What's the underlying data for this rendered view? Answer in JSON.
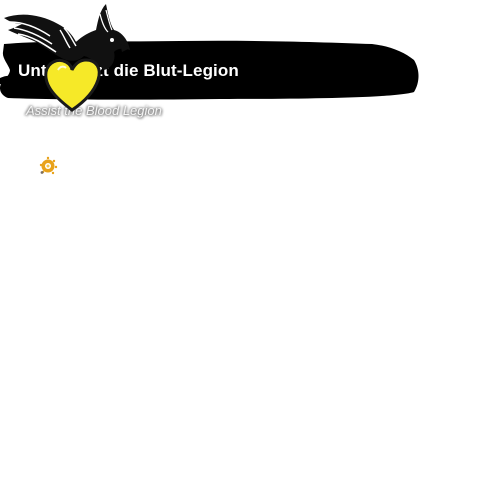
{
  "banner": {
    "title": "Unterstützt die Blut-Legion",
    "subtitle": "Assist the Blood Legion"
  },
  "emblem": {
    "eagle": "eagle-icon",
    "heart": "heart-icon",
    "heart_color": "#f6e928"
  },
  "badge": {
    "icon": "sun-medal-icon",
    "color": "#e8a21a"
  }
}
